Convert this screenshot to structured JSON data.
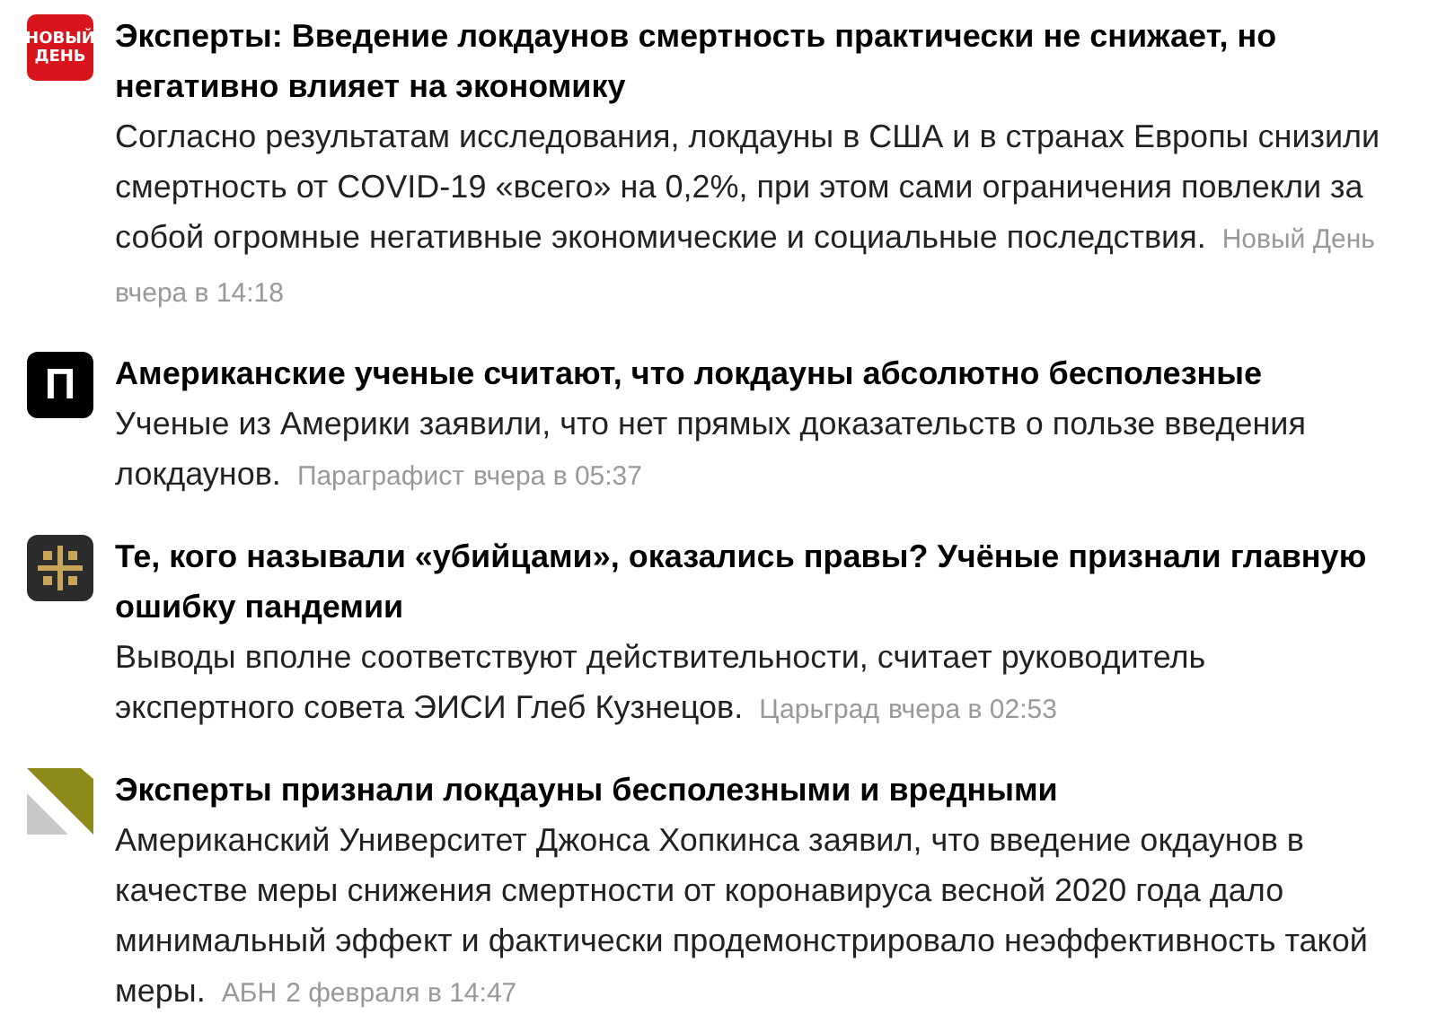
{
  "news": [
    {
      "logo": {
        "kind": "novy-den",
        "text": "НОВЫЙ ДЕНЬ"
      },
      "title": "Эксперты: Введение локдаунов смертность практически не снижает, но негативно влияет на экономику",
      "summary": "Согласно результатам исследования, локдауны в США и в странах Европы снизили смертность от COVID-19 «всего» на 0,2%, при этом сами ограничения повлекли за собой огромные негативные экономические и социальные последствия.",
      "source": "Новый День",
      "time": "вчера в 14:18"
    },
    {
      "logo": {
        "kind": "letter",
        "text": "П"
      },
      "title": "Американские ученые считают, что локдауны абсолютно бесполезные",
      "summary": "Ученые из Америки заявили, что нет прямых доказательств о пользе введения локдаунов.",
      "source": "Параграфист",
      "time": "вчера в 05:37"
    },
    {
      "logo": {
        "kind": "cross"
      },
      "title": "Те, кого называли «убийцами», оказались правы? Учёные признали главную ошибку пандемии",
      "summary": "Выводы вполне соответствуют действительности, считает руководитель экспертного совета ЭИСИ Глеб Кузнецов.",
      "source": "Царьград",
      "time": "вчера в 02:53"
    },
    {
      "logo": {
        "kind": "triangle"
      },
      "title": "Эксперты признали локдауны бесполезными и вредными",
      "summary": "Американский Университет Джонса Хопкинса заявил, что введение окдаунов в качестве меры снижения смертности от коронавируса весной 2020 года дало минимальный эффект и фактически продемонстрировало неэффективность такой меры.",
      "source": "АБН",
      "time": "2 февраля в 14:47"
    }
  ]
}
